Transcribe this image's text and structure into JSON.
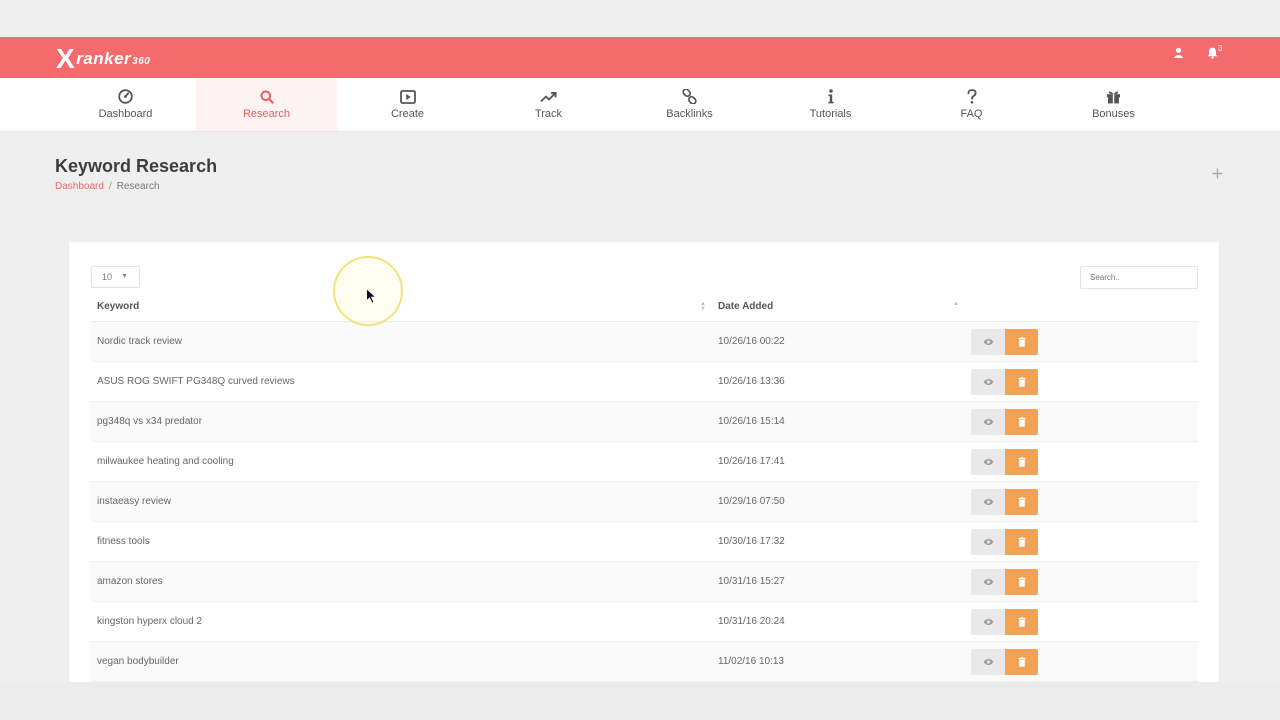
{
  "header": {
    "logo": {
      "x": "X",
      "word": "ranker",
      "suffix": "360"
    },
    "user_icon": "user-icon",
    "bell_icon": "bell-icon",
    "notification_count": "3"
  },
  "nav": {
    "items": [
      {
        "id": "dashboard",
        "label": "Dashboard",
        "icon": "dashboard-gauge-icon",
        "active": false
      },
      {
        "id": "research",
        "label": "Research",
        "icon": "search-icon",
        "active": true
      },
      {
        "id": "create",
        "label": "Create",
        "icon": "play-icon",
        "active": false
      },
      {
        "id": "track",
        "label": "Track",
        "icon": "trend-up-icon",
        "active": false
      },
      {
        "id": "backlinks",
        "label": "Backlinks",
        "icon": "link-icon",
        "active": false
      },
      {
        "id": "tutorials",
        "label": "Tutorials",
        "icon": "info-icon",
        "active": false
      },
      {
        "id": "faq",
        "label": "FAQ",
        "icon": "question-icon",
        "active": false
      },
      {
        "id": "bonuses",
        "label": "Bonuses",
        "icon": "gift-icon",
        "active": false
      }
    ]
  },
  "page": {
    "title": "Keyword Research",
    "breadcrumb": {
      "home": "Dashboard",
      "separator": "/",
      "current": "Research"
    },
    "add_icon": "plus-icon"
  },
  "table": {
    "page_length": "10",
    "search_placeholder": "Search..",
    "columns": {
      "keyword": "Keyword",
      "date_added": "Date Added"
    },
    "rows": [
      {
        "keyword": "Nordic track review",
        "date": "10/26/16 00:22"
      },
      {
        "keyword": "ASUS ROG SWIFT PG348Q curved reviews",
        "date": "10/26/16 13:36"
      },
      {
        "keyword": "pg348q vs x34 predator",
        "date": "10/26/16 15:14"
      },
      {
        "keyword": "milwaukee heating and cooling",
        "date": "10/26/16 17:41"
      },
      {
        "keyword": "instaeasy review",
        "date": "10/29/16 07:50"
      },
      {
        "keyword": "fitness tools",
        "date": "10/30/16 17:32"
      },
      {
        "keyword": "amazon stores",
        "date": "10/31/16 15:27"
      },
      {
        "keyword": "kingston hyperx cloud 2",
        "date": "10/31/16 20:24"
      },
      {
        "keyword": "vegan bodybuilder",
        "date": "11/02/16 10:13"
      }
    ],
    "view_icon": "eye-icon",
    "delete_icon": "trash-icon"
  },
  "colors": {
    "brand": "#f46b6e",
    "active_nav_text": "#e8605f",
    "delete_button": "#f2a155",
    "view_button": "#e9e9e9"
  }
}
